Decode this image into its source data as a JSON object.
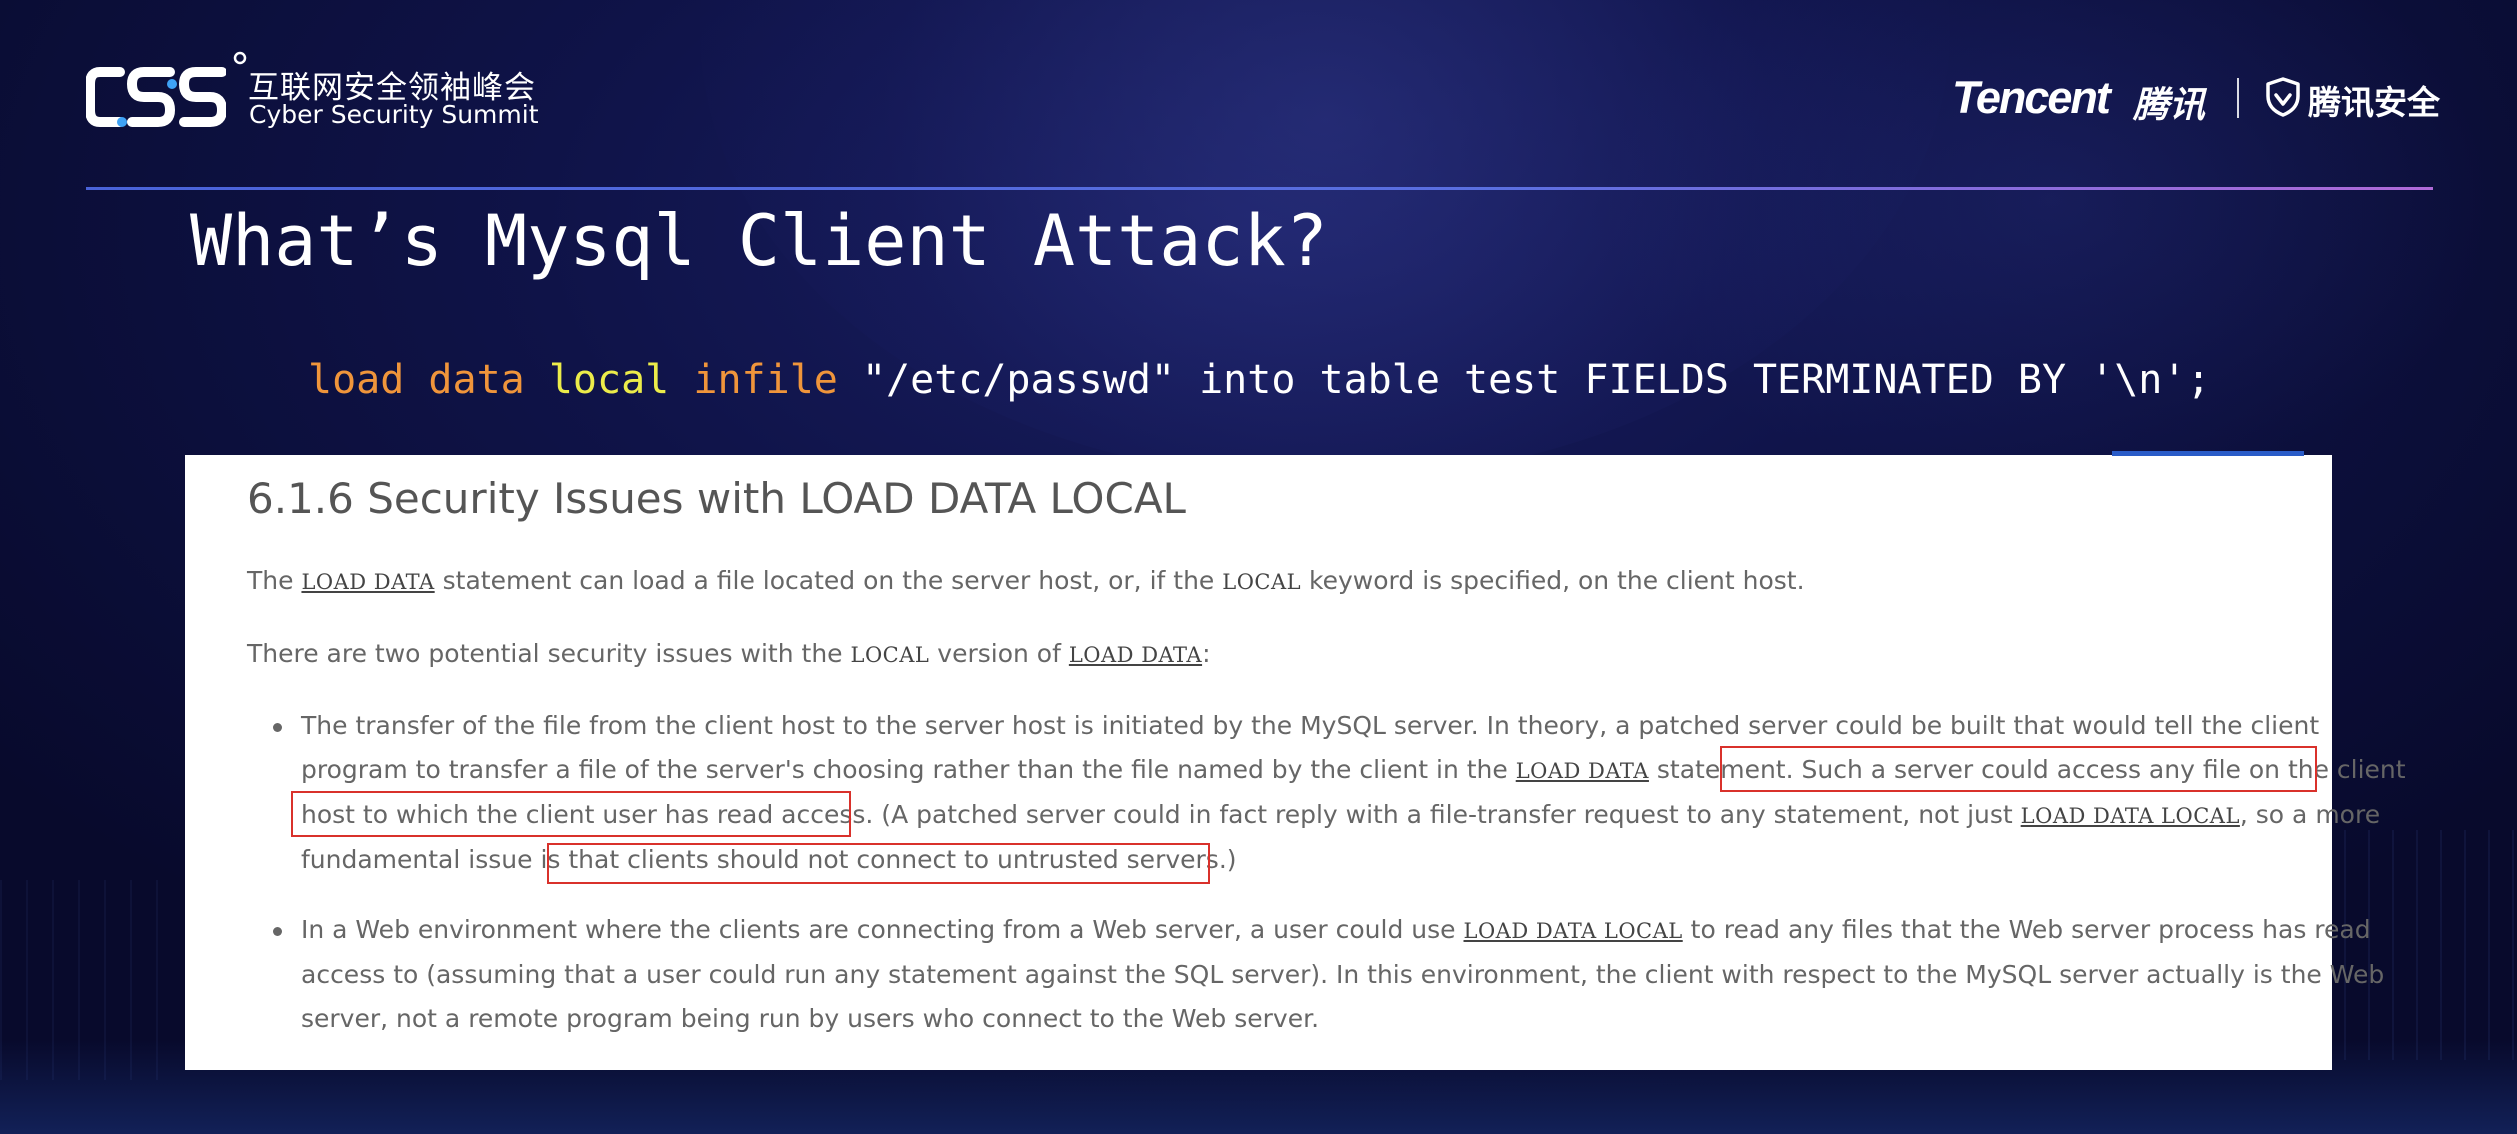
{
  "header": {
    "css_logo_text": "CSS",
    "summit_name_cn": "互联网安全领袖峰会",
    "summit_name_en": "Cyber Security Summit",
    "tencent_word": "Tencent",
    "tencent_cn": "腾讯",
    "security_cn": "腾讯安全"
  },
  "slide": {
    "title": "What’s Mysql Client Attack?",
    "code": {
      "kw_load": "load",
      "kw_data": "data",
      "kw_local": "local",
      "kw_infile": "infile",
      "rest": " \"/etc/passwd\" into table test FIELDS TERMINATED BY '\\n';"
    }
  },
  "doc": {
    "heading": "6.1.6 Security Issues with LOAD DATA LOCAL",
    "p1": {
      "t1": "The ",
      "code1": "LOAD DATA",
      "t2": " statement can load a file located on the server host, or, if the ",
      "code2": "LOCAL",
      "t3": " keyword is specified, on the client host."
    },
    "p2": {
      "t1": "There are two potential security issues with the ",
      "code1": "LOCAL",
      "t2": " version of ",
      "code2": "LOAD DATA",
      "t3": ":"
    },
    "bullet1": {
      "line1": "The transfer of the file from the client host to the server host is initiated by the MySQL server. In theory, a patched server could be built that would tell the client",
      "line2_t1": "program to transfer a file of the server's choosing rather than the file named by the client in the ",
      "line2_code": "LOAD DATA",
      "line2_t2": " statement. Such a server could access any file on the client",
      "line3_t1": "host to which the client user has read access. (A patched server could in fact reply with a file-transfer request to any statement, not just ",
      "line3_code": "LOAD DATA LOCAL",
      "line3_t2": ", so a more",
      "line4": "fundamental issue is that clients should not connect to untrusted servers.)"
    },
    "bullet2": {
      "line1_t1": "In a Web environment where the clients are connecting from a Web server, a user could use ",
      "line1_code": "LOAD DATA LOCAL",
      "line1_t2": " to read any files that the Web server process has read",
      "line2": "access to (assuming that a user could run any statement against the SQL server). In this environment, the client with respect to the MySQL server actually is the Web",
      "line3": "server, not a remote program being run by users who connect to the Web server."
    }
  },
  "colors": {
    "background": "#0f1348",
    "keyword_orange": "#f0953b",
    "keyword_yellow": "#ecec4a",
    "highlight_box": "#d9312b",
    "rule_gradient_start": "#4a63d9",
    "rule_gradient_end": "#b06ad8"
  },
  "icons": [
    "css-logo-icon",
    "tencent-shield-icon"
  ]
}
